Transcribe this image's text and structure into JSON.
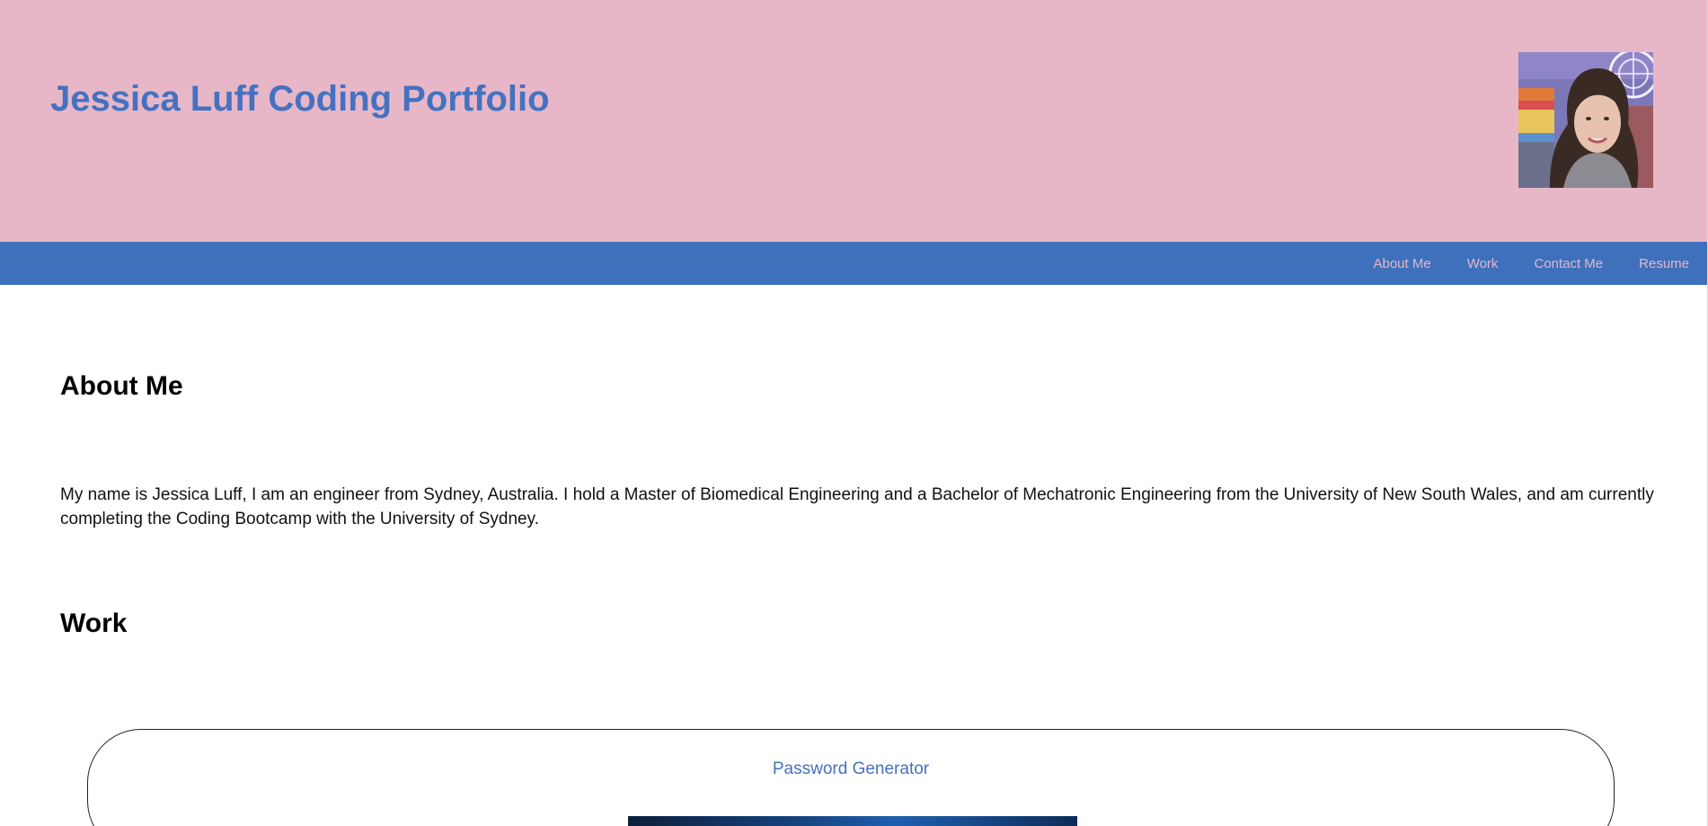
{
  "header": {
    "title": "Jessica Luff Coding Portfolio",
    "profile_photo": "profile-photo"
  },
  "nav": {
    "items": [
      {
        "label": "About Me"
      },
      {
        "label": "Work"
      },
      {
        "label": "Contact Me"
      },
      {
        "label": "Resume"
      }
    ]
  },
  "about": {
    "heading": "About Me",
    "text": "My name is Jessica Luff, I am an engineer from Sydney, Australia. I hold a Master of Biomedical Engineering and a Bachelor of Mechatronic Engineering from the University of New South Wales, and am currently completing the Coding Bootcamp with the University of Sydney."
  },
  "work": {
    "heading": "Work",
    "projects": [
      {
        "title": "Password Generator"
      }
    ]
  },
  "colors": {
    "header_bg": "#e7b7c8",
    "nav_bg": "#3f70bc",
    "accent": "#4472c0"
  }
}
